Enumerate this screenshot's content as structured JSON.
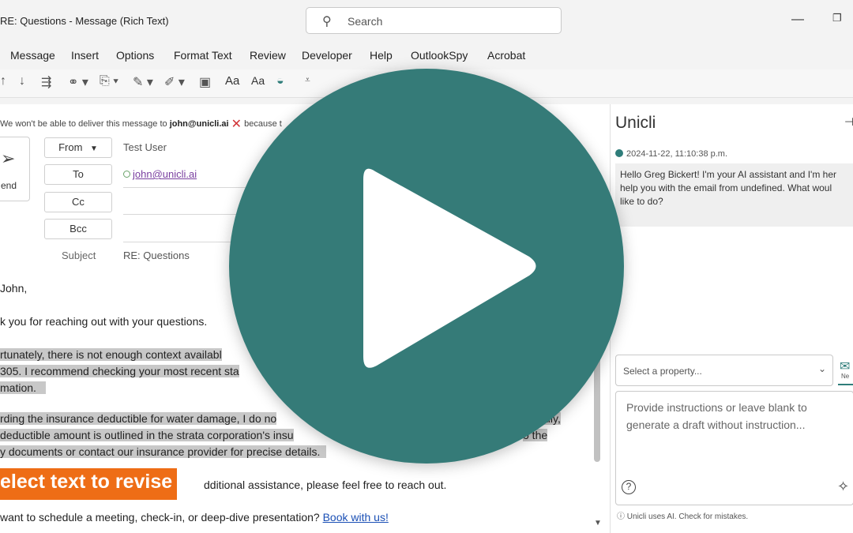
{
  "window": {
    "title": "RE: Questions  -  Message (Rich Text)",
    "search_placeholder": "Search",
    "minimize_glyph": "—",
    "maximize_glyph": "❐"
  },
  "menu": [
    "Message",
    "Insert",
    "Options",
    "Format Text",
    "Review",
    "Developer",
    "Help",
    "OutlookSpy",
    "Acrobat"
  ],
  "ribbon": {
    "aa_large": "Aa",
    "aa_small": "Aa"
  },
  "compose": {
    "warning_prefix": "We won't be able to deliver this message to",
    "warning_email": "john@unicli.ai",
    "warning_suffix": "because t",
    "send_label": "end",
    "from_label": "From",
    "from_value": "Test User",
    "to_label": "To",
    "to_value": "john@unicli.ai",
    "cc_label": "Cc",
    "bcc_label": "Bcc",
    "subject_label": "Subject",
    "subject_value": "RE: Questions"
  },
  "body": {
    "greeting": " John,",
    "thanks": "k you for reaching out with your questions.",
    "p1_l1": "rtunately, there is not enough context availabl",
    "p1_l2": "305. I recommend checking your most recent sta",
    "p1_l3": "mation.",
    "p2_l1": "rding the insurance deductible for water damage, I do no",
    "p2_l1_right": "ally,",
    "p2_l2": "deductible amount is outlined in the strata corporation's insu",
    "p2_l2_right": "o the",
    "p2_l3": "y documents or contact our insurance provider for precise details.",
    "revise_badge": "elect text to revise",
    "p3_rest": "dditional assistance, please feel free to reach out.",
    "p4_text": "want to schedule a meeting, check-in, or deep-dive presentation? ",
    "p4_link": "Book with us!"
  },
  "panel": {
    "title": "Unicli",
    "timestamp": "2024-11-22, 11:10:38 p.m.",
    "message_l1": "Hello Greg Bickert! I'm your AI assistant and I'm her",
    "message_l2": "help you with the email from undefined. What woul",
    "message_l3": "like to do?",
    "select_placeholder": "Select a property...",
    "new_tab_label": "Ne",
    "instructions_l1": "Provide instructions or leave blank to",
    "instructions_l2": "generate a draft without instruction...",
    "help_glyph": "?",
    "disclaimer": "Unicli uses AI. Check for mistakes."
  },
  "colors": {
    "play_overlay": "#357b78",
    "revise_badge": "#ee6d16",
    "link": "#1a4fb5",
    "highlight": "#c8c8c8"
  }
}
